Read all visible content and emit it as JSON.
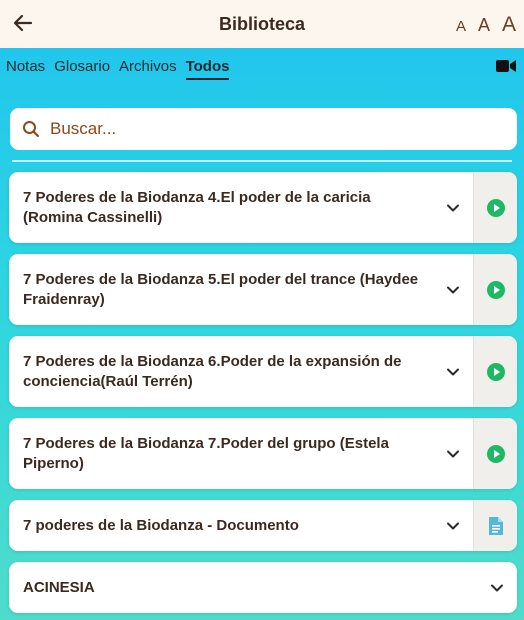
{
  "header": {
    "title": "Biblioteca",
    "font_small": "A",
    "font_medium": "A",
    "font_large": "A"
  },
  "tabs": [
    {
      "label": "Notas",
      "active": false
    },
    {
      "label": "Glosario",
      "active": false
    },
    {
      "label": "Archivos",
      "active": false
    },
    {
      "label": "Todos",
      "active": true
    }
  ],
  "search": {
    "placeholder": "Buscar..."
  },
  "items": [
    {
      "title": "7 Poderes de la Biodanza 4.El poder de la caricia (Romina Cassinelli)",
      "action_icon": "play-circle-icon"
    },
    {
      "title": "7 Poderes de la Biodanza 5.El poder del trance (Haydee Fraidenray)",
      "action_icon": "play-circle-icon"
    },
    {
      "title": "7 Poderes de la Biodanza 6.Poder de la expansión de conciencia(Raúl Terrén)",
      "action_icon": "play-circle-icon"
    },
    {
      "title": "7 Poderes de la Biodanza 7.Poder del grupo (Estela Piperno)",
      "action_icon": "play-circle-icon"
    },
    {
      "title": "7 poderes de la Biodanza - Documento",
      "action_icon": "document-icon"
    },
    {
      "title": "ACINESIA",
      "action_icon": null
    }
  ],
  "colors": {
    "header_bg": "#fdf6ee",
    "accent_brown": "#8a4a1c",
    "play_green": "#1fb865",
    "doc_teal": "#56b8d6"
  }
}
